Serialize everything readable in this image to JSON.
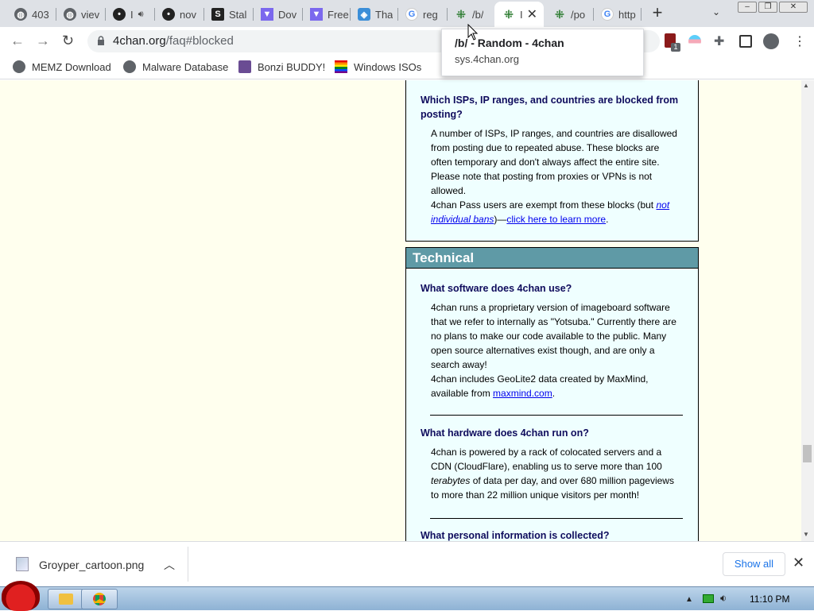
{
  "tabs": [
    {
      "title": "403",
      "icon": "globe-icon"
    },
    {
      "title": "viev",
      "icon": "globe-icon"
    },
    {
      "title": "I",
      "icon": "face-icon"
    },
    {
      "title": "nov",
      "icon": "face-icon"
    },
    {
      "title": "Stal",
      "icon": "s-icon"
    },
    {
      "title": "Dov",
      "icon": "triangle-icon"
    },
    {
      "title": "Free",
      "icon": "triangle-icon"
    },
    {
      "title": "Tha",
      "icon": "shield-icon"
    },
    {
      "title": "reg",
      "icon": "google-icon"
    },
    {
      "title": "/b/",
      "icon": "clover-icon"
    },
    {
      "title": "I",
      "icon": "clover-icon"
    },
    {
      "title": "/po",
      "icon": "clover-icon"
    },
    {
      "title": "http",
      "icon": "google-icon"
    }
  ],
  "url": {
    "domain": "4chan.org",
    "path": "/faq#blocked"
  },
  "bookmarks": [
    "MEMZ Download",
    "Malware Database",
    "Bonzi BUDDY!",
    "Windows ISOs"
  ],
  "tooltip": {
    "title": "/b/ - Random - 4chan",
    "url": "sys.4chan.org"
  },
  "blocked": {
    "question": "Which ISPs, IP ranges, and countries are blocked from posting?",
    "answer_1": "A number of ISPs, IP ranges, and countries are disallowed from posting due to repeated abuse. These blocks are often temporary and don't always affect the entire site. Please note that posting from proxies or VPNs is not allowed.",
    "answer_2_pre": "4chan Pass users are exempt from these blocks (but ",
    "answer_2_em": "not individual bans",
    "answer_2_mid": ")—",
    "answer_2_link": "click here to learn more",
    "answer_2_post": "."
  },
  "technical": {
    "heading": "Technical",
    "q1": "What software does 4chan use?",
    "a1": "4chan runs a proprietary version of imageboard software that we refer to internally as \"Yotsuba.\" Currently there are no plans to make our code available to the public. Many open source alternatives exist though, and are only a search away!",
    "a1b_pre": "4chan includes GeoLite2 data created by MaxMind, available from ",
    "a1b_link": "maxmind.com",
    "a1b_post": ".",
    "q2": "What hardware does 4chan run on?",
    "a2_pre": "4chan is powered by a rack of colocated servers and a CDN (CloudFlare), enabling us to serve more than 100 ",
    "a2_em": "terabytes",
    "a2_post": " of data per day, and over 680 million pageviews to more than 22 million unique visitors per month!",
    "q3": "What personal information is collected?"
  },
  "download": {
    "filename": "Groyper_cartoon.png",
    "show_all": "Show all"
  },
  "clock": "11:10 PM",
  "extension_badge": "1"
}
